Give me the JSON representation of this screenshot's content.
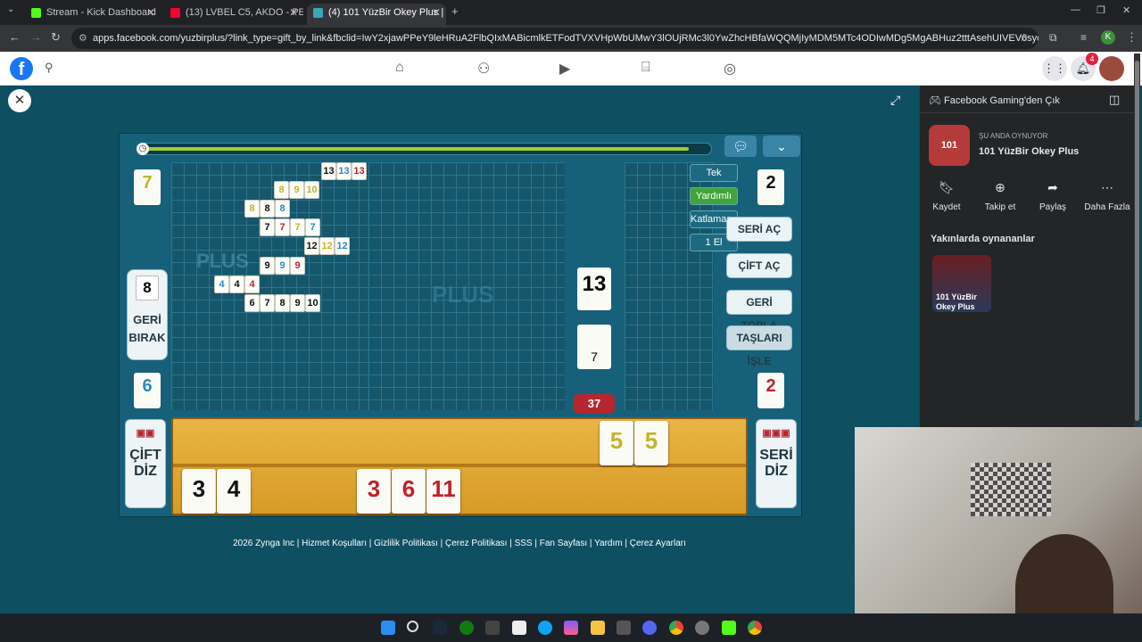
{
  "browser": {
    "tabs": [
      {
        "label": "Stream - Kick Dashboard",
        "favicon_color": "#53fc18"
      },
      {
        "label": "(13) LVBEL C5, AKDO - PEK",
        "favicon_color": "#ff0033"
      },
      {
        "label": "(4) 101 YüzBir Okey Plus | Faceb",
        "favicon_color": "#1877f2"
      }
    ],
    "url": "apps.facebook.com/yuzbirplus/?link_type=gift_by_link&fbclid=IwY2xjawPPeY9leHRuA2FlbQIxMABicmlkETFodTVXVHpWbUMwY3lOUjRMc3l0YwZhcHBfaWQQMjIyMDM5MTc4ODIwMDg5MgABHuz2tttAsehUIVEV6syd3op6ACeAY237ZLwvOogwpCMhT...",
    "profile_initial": "K"
  },
  "facebook": {
    "notification_count": "4",
    "exit_label": "Facebook Gaming'den Çık",
    "now_playing_label": "ŞU ANDA OYNUYOR",
    "game_title": "101 YüzBir Okey Plus",
    "actions": [
      {
        "label": "Kaydet",
        "icon": "bookmark-icon"
      },
      {
        "label": "Takip et",
        "icon": "follow-icon"
      },
      {
        "label": "Paylaş",
        "icon": "share-icon"
      },
      {
        "label": "Daha Fazla",
        "icon": "more-icon"
      }
    ],
    "nearby_title": "Yakınlarda oynananlar",
    "nearby_game": "101 YüzBir Okey Plus"
  },
  "game": {
    "left_top_tile": "7",
    "left_top_tile_color": "#c9b12a",
    "discard_count": "8",
    "discard_label_1": "GERİ",
    "discard_label_2": "BIRAK",
    "left_bottom_tile": "6",
    "left_bottom_tile_color": "#2a8ac8",
    "right_top_tile": "2",
    "right_bottom_tile": "2",
    "right_bottom_tile_color": "#c0202a",
    "modes": [
      "Tek",
      "Yardımlı",
      "Katlamasız",
      "1 El"
    ],
    "indicator_tile": "13",
    "deck_tile": "7",
    "remaining": "37",
    "buttons": {
      "seri_ac": "SERİ AÇ",
      "cift_ac": "ÇİFT AÇ",
      "geri_topla": "GERİ TOPLA",
      "taslari_isle": "TAŞLARI İŞLE"
    },
    "cift_diz_1": "ÇİFT",
    "cift_diz_2": "DİZ",
    "seri_diz_1": "SERİ",
    "seri_diz_2": "DİZ",
    "table_melds": [
      [
        {
          "n": "13",
          "c": "#111"
        },
        {
          "n": "13",
          "c": "#2a8ac8"
        },
        {
          "n": "13",
          "c": "#c0202a"
        }
      ],
      [
        {
          "n": "8",
          "c": "#c9b12a"
        },
        {
          "n": "9",
          "c": "#c9b12a"
        },
        {
          "n": "10",
          "c": "#c9b12a"
        }
      ],
      [
        {
          "n": "8",
          "c": "#c9b12a"
        },
        {
          "n": "8",
          "c": "#111"
        },
        {
          "n": "8",
          "c": "#2a8ac8"
        }
      ],
      [
        {
          "n": "7",
          "c": "#111"
        },
        {
          "n": "7",
          "c": "#c0202a"
        },
        {
          "n": "7",
          "c": "#c9b12a"
        },
        {
          "n": "7",
          "c": "#2a8ac8"
        }
      ],
      [
        {
          "n": "12",
          "c": "#111"
        },
        {
          "n": "12",
          "c": "#c9b12a"
        },
        {
          "n": "12",
          "c": "#2a8ac8"
        }
      ],
      [
        {
          "n": "9",
          "c": "#111"
        },
        {
          "n": "9",
          "c": "#2a8ac8"
        },
        {
          "n": "9",
          "c": "#c0202a"
        }
      ],
      [
        {
          "n": "4",
          "c": "#2a8ac8"
        },
        {
          "n": "4",
          "c": "#111"
        },
        {
          "n": "4",
          "c": "#c0202a"
        }
      ],
      [
        {
          "n": "6",
          "c": "#111"
        },
        {
          "n": "7",
          "c": "#111"
        },
        {
          "n": "8",
          "c": "#111"
        },
        {
          "n": "9",
          "c": "#111"
        },
        {
          "n": "10",
          "c": "#111"
        }
      ]
    ],
    "rack_top": [
      {
        "n": "5",
        "c": "#c9b12a"
      },
      {
        "n": "5",
        "c": "#c9b12a"
      }
    ],
    "rack_bottom_left": [
      {
        "n": "3",
        "c": "#111"
      },
      {
        "n": "4",
        "c": "#111"
      }
    ],
    "rack_bottom_mid": [
      {
        "n": "3",
        "c": "#c0202a"
      },
      {
        "n": "6",
        "c": "#c0202a"
      },
      {
        "n": "11",
        "c": "#c0202a"
      }
    ]
  },
  "footer": "2026 Zynga Inc | Hizmet Koşulları | Gizlilik Politikası | Çerez Politikası | SSS | Fan Sayfası | Yardım | Çerez Ayarları"
}
